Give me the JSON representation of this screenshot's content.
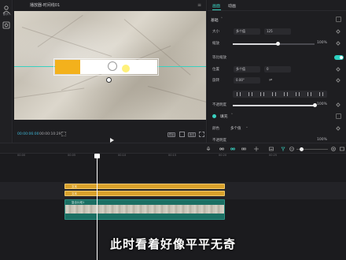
{
  "rail": {
    "items": [
      {
        "label": "数字人",
        "icon": "avatar-icon"
      },
      {
        "label": "",
        "icon": "filter-icon"
      }
    ]
  },
  "player": {
    "title": "播放器-时间线01",
    "menu_icon": "more-icon",
    "timecode_current": "00:00:06:00",
    "timecode_total": "00:00:10:29",
    "ratio_label": "原始",
    "fit_label": "适应",
    "full_icon": "fullscreen-icon"
  },
  "inspector": {
    "tabs": [
      {
        "label": "画面",
        "active": true
      },
      {
        "label": "动画",
        "active": false
      }
    ],
    "basic_section": "基础",
    "size_label": "大小",
    "size_x_value": "多个值",
    "size_y_value": "125",
    "scale_label": "缩放",
    "scale_value": "100%",
    "scale_level": 0.55,
    "lock_label": "等比缩放",
    "lock_on": true,
    "position_label": "位置",
    "position_x_value": "多个值",
    "position_y_value": "0",
    "rotate_label": "旋转",
    "rotate_value": "0.00°",
    "opacity_label": "不透明度",
    "opacity_value": "100%",
    "opacity_level": 1.0,
    "fill_section": "填充",
    "color_label": "颜色",
    "color_value": "多个值",
    "alpha_label": "不透明度",
    "alpha_value": "100%"
  },
  "colors": {
    "accent": "#39d1c0",
    "text_clip": "#d9a12b",
    "video_clip": "#1b6f63",
    "yellow_bar": "#f3b11c",
    "timecode": "#3fb6d6"
  },
  "timeline": {
    "ruler_labels": [
      "00:00",
      "00:05",
      "00:10",
      "00:15",
      "00:20",
      "00:25"
    ],
    "text_clip_1": "文本",
    "text_clip_2": "文本",
    "video_clip": "复合片段1",
    "subtitle": "此时看着好像平平无奇"
  }
}
